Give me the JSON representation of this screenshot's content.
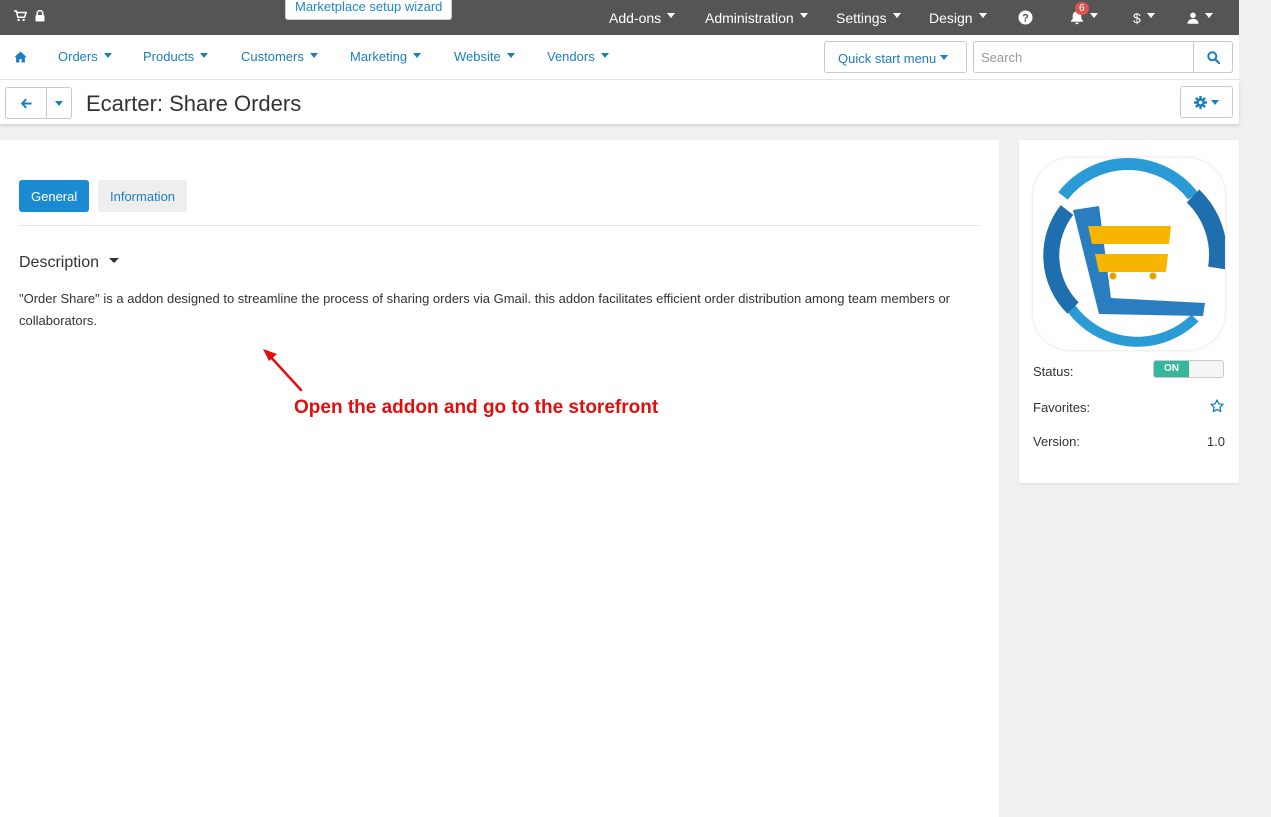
{
  "topbar": {
    "wizard_label": "Marketplace setup wizard",
    "menus": [
      "Add-ons",
      "Administration",
      "Settings",
      "Design"
    ],
    "notifications_count": "6",
    "currency_label": "$"
  },
  "navbar": {
    "items": [
      "Orders",
      "Products",
      "Customers",
      "Marketing",
      "Website",
      "Vendors"
    ],
    "quick_start_label": "Quick start menu",
    "search_placeholder": "Search"
  },
  "titlebar": {
    "title": "Ecarter: Share Orders"
  },
  "main": {
    "tabs": [
      {
        "label": "General",
        "active": true
      },
      {
        "label": "Information",
        "active": false
      }
    ],
    "section_title": "Description",
    "description": "\"Order Share\" is a addon designed to streamline the process of sharing orders via Gmail. this addon facilitates efficient order distribution among team members or collaborators.",
    "annotation": "Open the addon and go to the storefront"
  },
  "sidepanel": {
    "status_label": "Status:",
    "status_toggle": "ON",
    "favorites_label": "Favorites:",
    "version_label": "Version:",
    "version_value": "1.0"
  },
  "colors": {
    "topbar_bg": "#555555",
    "link_blue": "#1b7fbf",
    "active_tab": "#1a8bd0",
    "toggle_on": "#35b79b",
    "annotation_red": "#e10e0e",
    "badge_red": "#d9534f"
  },
  "icons": [
    "cart-icon",
    "lock-icon",
    "question-icon",
    "bell-icon",
    "user-icon",
    "home-icon",
    "search-icon",
    "back-arrow-icon",
    "gear-icon",
    "star-icon",
    "addon-logo"
  ]
}
